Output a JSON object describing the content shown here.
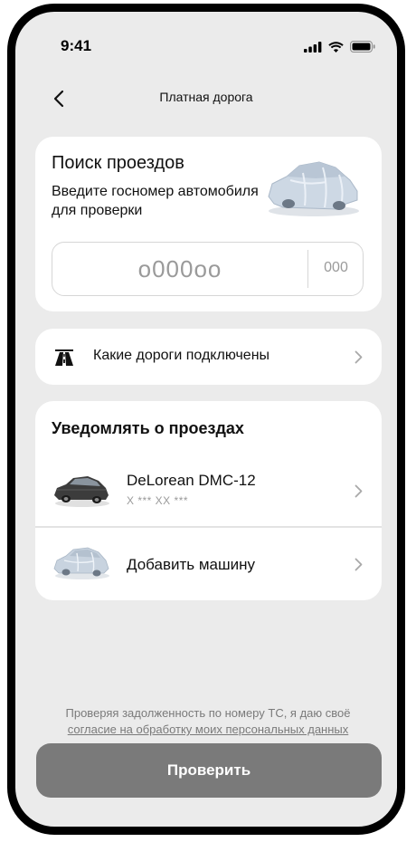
{
  "status_bar": {
    "time": "9:41"
  },
  "nav": {
    "title": "Платная дорога"
  },
  "search": {
    "title": "Поиск проездов",
    "subtitle": "Введите госномер автомобиля для проверки",
    "plate_placeholder": "о000оо",
    "region_placeholder": "000"
  },
  "roads": {
    "label": "Какие дороги подключены"
  },
  "notify": {
    "title": "Уведомлять о проездах",
    "cars": [
      {
        "name": "DeLorean DMC-12",
        "plate": "X *** XX ***"
      }
    ],
    "add_label": "Добавить машину"
  },
  "consent": {
    "text": "Проверяя задолженность по номеру ТС, я даю своё",
    "link": "согласие на обработку моих персональных данных"
  },
  "check_button": "Проверить",
  "colors": {
    "background": "#ebebeb",
    "card": "#ffffff",
    "button": "#7a7a7a",
    "muted_text": "#9a9a9a"
  }
}
